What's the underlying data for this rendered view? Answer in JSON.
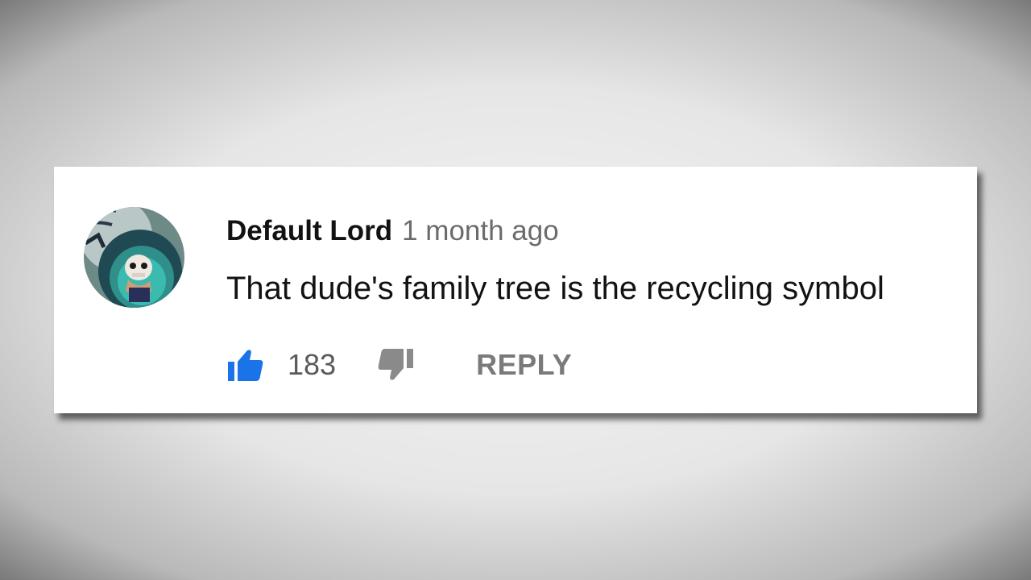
{
  "comment": {
    "author": "Default Lord",
    "timestamp": "1 month ago",
    "text": "That dude's family tree is the recycling symbol",
    "likes": "183",
    "reply_label": "REPLY",
    "avatar_icon": "avatar-image",
    "like_icon": "thumbs-up-icon",
    "dislike_icon": "thumbs-down-icon"
  },
  "colors": {
    "like_active": "#1a73e8",
    "dislike": "#8a8a8a",
    "author": "#121212",
    "muted": "#6b6b6b"
  }
}
